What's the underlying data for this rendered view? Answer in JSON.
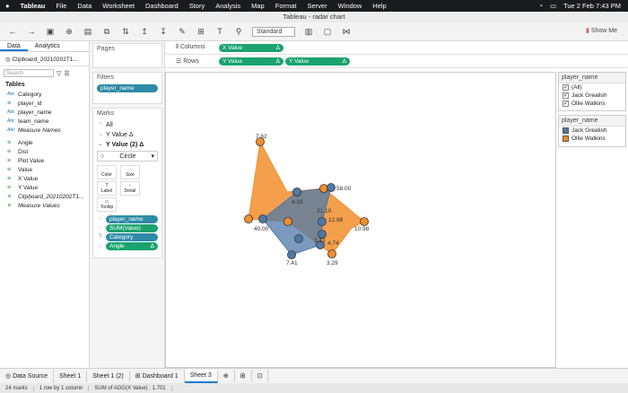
{
  "menubar": {
    "apple": "",
    "app": "Tableau",
    "items": [
      "File",
      "Data",
      "Worksheet",
      "Dashboard",
      "Story",
      "Analysis",
      "Map",
      "Format",
      "Server",
      "Window",
      "Help"
    ],
    "clock": "Tue 2 Feb  7:43 PM"
  },
  "window": {
    "title": "Tableau - radar chart"
  },
  "toolbar": {
    "standard": "Standard",
    "show_me": "Show Me"
  },
  "left": {
    "tab_data": "Data",
    "tab_analytics": "Analytics",
    "datasource": "Clipboard_20210202T1...",
    "search_placeholder": "Search",
    "tables_label": "Tables",
    "fields": [
      {
        "icon": "Abc",
        "name": "Category",
        "type": "d"
      },
      {
        "icon": "⊕",
        "name": "player_id",
        "type": "d"
      },
      {
        "icon": "Abc",
        "name": "player_name",
        "type": "d"
      },
      {
        "icon": "Abc",
        "name": "team_name",
        "type": "d"
      },
      {
        "icon": "Abc",
        "name": "Measure Names",
        "type": "d",
        "italic": true
      }
    ],
    "measures": [
      {
        "icon": "⊕",
        "name": "Angle"
      },
      {
        "icon": "⊕",
        "name": "Dist"
      },
      {
        "icon": "⊕",
        "name": "Plot Value"
      },
      {
        "icon": "⊕",
        "name": "Value"
      },
      {
        "icon": "⊕",
        "name": "X Value"
      },
      {
        "icon": "⊕",
        "name": "Y Value"
      },
      {
        "icon": "⊕",
        "name": "Clipboard_20210202T1...",
        "italic": true
      },
      {
        "icon": "⊕",
        "name": "Measure Values",
        "italic": true
      }
    ]
  },
  "cards": {
    "pages": "Pages",
    "filters": "Filters",
    "filter_pill": "player_name",
    "marks": "Marks",
    "all": "All",
    "y1": "Y Value",
    "y2": "Y Value (2)",
    "mark_type": "Circle",
    "buttons": [
      "Color",
      "Size",
      "Label",
      "Detail",
      "Tooltip"
    ],
    "mark_pills": [
      {
        "name": "player_name",
        "color": "b"
      },
      {
        "name": "SUM(Value)",
        "color": "g"
      },
      {
        "name": "Category",
        "color": "b"
      },
      {
        "name": "Angle",
        "color": "g",
        "delta": "Δ"
      }
    ]
  },
  "shelves": {
    "columns_label": "Columns",
    "rows_label": "Rows",
    "columns": [
      "X Value"
    ],
    "rows": [
      "Y Value",
      "Y Value"
    ],
    "delta": "Δ"
  },
  "filter_card": {
    "title": "player_name",
    "items": [
      "(All)",
      "Jack Grealish",
      "Ollie Watkins"
    ]
  },
  "legend": {
    "title": "player_name",
    "items": [
      {
        "name": "Jack Grealish",
        "color": "#4e79a7"
      },
      {
        "name": "Ollie Watkins",
        "color": "#f28e2b"
      }
    ]
  },
  "sheets": [
    "Data Source",
    "Sheet 1",
    "Sheet 1 (2)",
    "Dashboard 1",
    "Sheet 3"
  ],
  "active_sheet": "Sheet 3",
  "status": {
    "marks": "24 marks",
    "rows": "1 row by 1 column",
    "sum": "SUM of AGG(X Value) : 1.701"
  },
  "chart_data": {
    "type": "radar",
    "series": [
      {
        "name": "Ollie Watkins",
        "color": "#f28e2b",
        "labels": [
          "7.62",
          "",
          "",
          "40.00",
          "",
          "",
          "3.29",
          "10.98",
          "",
          "",
          "",
          ""
        ]
      },
      {
        "name": "Jack Grealish",
        "color": "#4e79a7",
        "labels": [
          "",
          "58.00",
          "4.16",
          "",
          "21.10",
          "12.98",
          "2.13",
          "4.74",
          "7.41",
          "",
          "",
          ""
        ]
      }
    ]
  }
}
